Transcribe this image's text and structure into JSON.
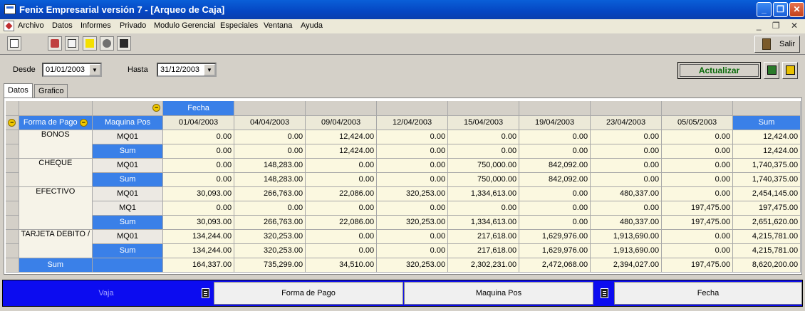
{
  "window": {
    "title": "Fenix Empresarial versión 7 - [Arqueo de Caja]"
  },
  "menu": [
    "Archivo",
    "Datos",
    "Informes",
    "Privado",
    "Modulo Gerencial",
    "Especiales",
    "Ventana",
    "Ayuda"
  ],
  "toolbar": {
    "salir_label": "Salir"
  },
  "filters": {
    "desde_label": "Desde",
    "desde_value": "01/01/2003",
    "hasta_label": "Hasta",
    "hasta_value": "31/12/2003",
    "actualizar_label": "Actualizar"
  },
  "tabs": [
    "Datos",
    "Grafico"
  ],
  "pivot": {
    "col_field": "Fecha",
    "row_field_1": "Forma de Pago",
    "row_field_2": "Maquina Pos",
    "dates": [
      "01/04/2003",
      "04/04/2003",
      "09/04/2003",
      "12/04/2003",
      "15/04/2003",
      "19/04/2003",
      "23/04/2003",
      "05/05/2003"
    ],
    "sum_label": "Sum",
    "groups": [
      {
        "name": "BONOS",
        "rows": [
          {
            "label": "MQ01",
            "values": [
              "0.00",
              "0.00",
              "12,424.00",
              "0.00",
              "0.00",
              "0.00",
              "0.00",
              "0.00",
              "12,424.00"
            ]
          },
          {
            "label": "Sum",
            "sum": true,
            "values": [
              "0.00",
              "0.00",
              "12,424.00",
              "0.00",
              "0.00",
              "0.00",
              "0.00",
              "0.00",
              "12,424.00"
            ]
          }
        ]
      },
      {
        "name": "CHEQUE",
        "rows": [
          {
            "label": "MQ01",
            "values": [
              "0.00",
              "148,283.00",
              "0.00",
              "0.00",
              "750,000.00",
              "842,092.00",
              "0.00",
              "0.00",
              "1,740,375.00"
            ]
          },
          {
            "label": "Sum",
            "sum": true,
            "values": [
              "0.00",
              "148,283.00",
              "0.00",
              "0.00",
              "750,000.00",
              "842,092.00",
              "0.00",
              "0.00",
              "1,740,375.00"
            ]
          }
        ]
      },
      {
        "name": "EFECTIVO",
        "rows": [
          {
            "label": "MQ01",
            "values": [
              "30,093.00",
              "266,763.00",
              "22,086.00",
              "320,253.00",
              "1,334,613.00",
              "0.00",
              "480,337.00",
              "0.00",
              "2,454,145.00"
            ]
          },
          {
            "label": "MQ1",
            "values": [
              "0.00",
              "0.00",
              "0.00",
              "0.00",
              "0.00",
              "0.00",
              "0.00",
              "197,475.00",
              "197,475.00"
            ]
          },
          {
            "label": "Sum",
            "sum": true,
            "values": [
              "30,093.00",
              "266,763.00",
              "22,086.00",
              "320,253.00",
              "1,334,613.00",
              "0.00",
              "480,337.00",
              "197,475.00",
              "2,651,620.00"
            ]
          }
        ]
      },
      {
        "name": "TARJETA DEBITO /",
        "rows": [
          {
            "label": "MQ01",
            "values": [
              "134,244.00",
              "320,253.00",
              "0.00",
              "0.00",
              "217,618.00",
              "1,629,976.00",
              "1,913,690.00",
              "0.00",
              "4,215,781.00"
            ]
          },
          {
            "label": "Sum",
            "sum": true,
            "values": [
              "134,244.00",
              "320,253.00",
              "0.00",
              "0.00",
              "217,618.00",
              "1,629,976.00",
              "1,913,690.00",
              "0.00",
              "4,215,781.00"
            ]
          }
        ]
      }
    ],
    "grand_total": {
      "label": "Sum",
      "values": [
        "164,337.00",
        "735,299.00",
        "34,510.00",
        "320,253.00",
        "2,302,231.00",
        "2,472,068.00",
        "2,394,027.00",
        "197,475.00",
        "8,620,200.00"
      ]
    }
  },
  "bottom": {
    "vista_label": "Vaja",
    "field_1": "Forma de Pago",
    "field_2": "Maquina Pos",
    "field_3": "Fecha"
  }
}
